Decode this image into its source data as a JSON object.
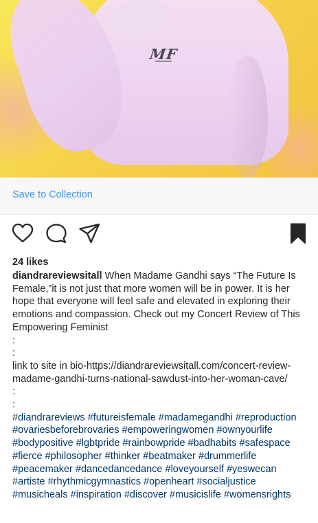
{
  "photo": {
    "shirt_logo": "MF"
  },
  "save_bar": {
    "save_label": "Save to Collection"
  },
  "actions": {
    "like_icon": "heart-outline-icon",
    "comment_icon": "comment-bubble-icon",
    "share_icon": "paper-plane-icon",
    "save_icon": "bookmark-filled-icon"
  },
  "post": {
    "likes": "24 likes",
    "username": "diandrareviewsitall",
    "caption_text": "When Madame Gandhi says “The Future Is Female,”it is not just that more women will be in power. It is her hope that everyone will feel safe and elevated in exploring their emotions and compassion. Check out my Concert Review of This Empowering Feminist",
    "dot_1": ":",
    "dot_2": ":",
    "link_line": "link to site in bio-https://diandrareviewsitall.com/concert-review-madame-gandhi-turns-national-sawdust-into-her-woman-cave/",
    "dot_3": ":",
    "dot_4": ":",
    "hashtags": [
      "#diandrareviews",
      "#futureisfemale",
      "#madamegandhi",
      "#reproduction",
      "#ovariesbeforebrovaries",
      "#empoweringwomen",
      "#ownyourlife",
      "#bodypositive",
      "#lgbtpride",
      "#rainbowpride",
      "#badhabits",
      "#safespace",
      "#fierce",
      "#philosopher",
      "#thinker",
      "#beatmaker",
      "#drummerlife",
      "#peacemaker",
      "#dancedancedance",
      "#loveyourself",
      "#yeswecan",
      "#artiste",
      "#rhythmicgymnastics",
      "#openheart",
      "#socialjustice",
      "#musicheals",
      "#inspiration",
      "#discover",
      "#musicislife",
      "#womensrights"
    ]
  }
}
